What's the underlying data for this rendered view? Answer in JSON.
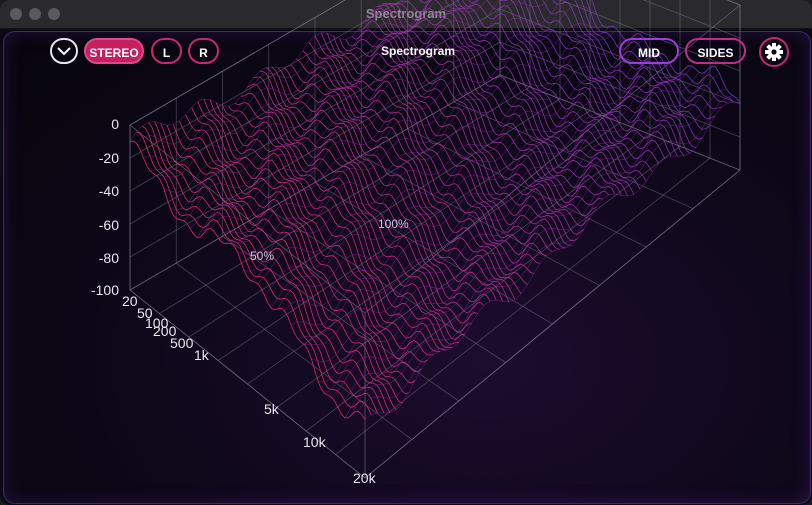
{
  "window": {
    "title": "Spectrogram",
    "traffic_lights": [
      "close",
      "minimize",
      "zoom"
    ]
  },
  "toolbar": {
    "collapse_icon": "chevron-down-icon",
    "channels": [
      {
        "label": "STEREO",
        "active": true
      },
      {
        "label": "L",
        "active": false
      },
      {
        "label": "R",
        "active": false
      }
    ],
    "title": "Spectrogram",
    "modes": [
      {
        "label": "MID",
        "active": false
      },
      {
        "label": "SIDES",
        "active": false
      }
    ],
    "settings_icon": "gear-icon"
  },
  "plot": {
    "db_ticks": [
      "0",
      "-20",
      "-40",
      "-60",
      "-80",
      "-100"
    ],
    "freq_ticks": [
      "20",
      "50",
      "100",
      "200",
      "500",
      "1k",
      "5k",
      "10k",
      "20k"
    ],
    "time_labels": [
      "50%",
      "100%"
    ],
    "colors": {
      "low": "#5b3ff0",
      "high": "#ff2a6a",
      "grid": "#8a86a0"
    }
  }
}
